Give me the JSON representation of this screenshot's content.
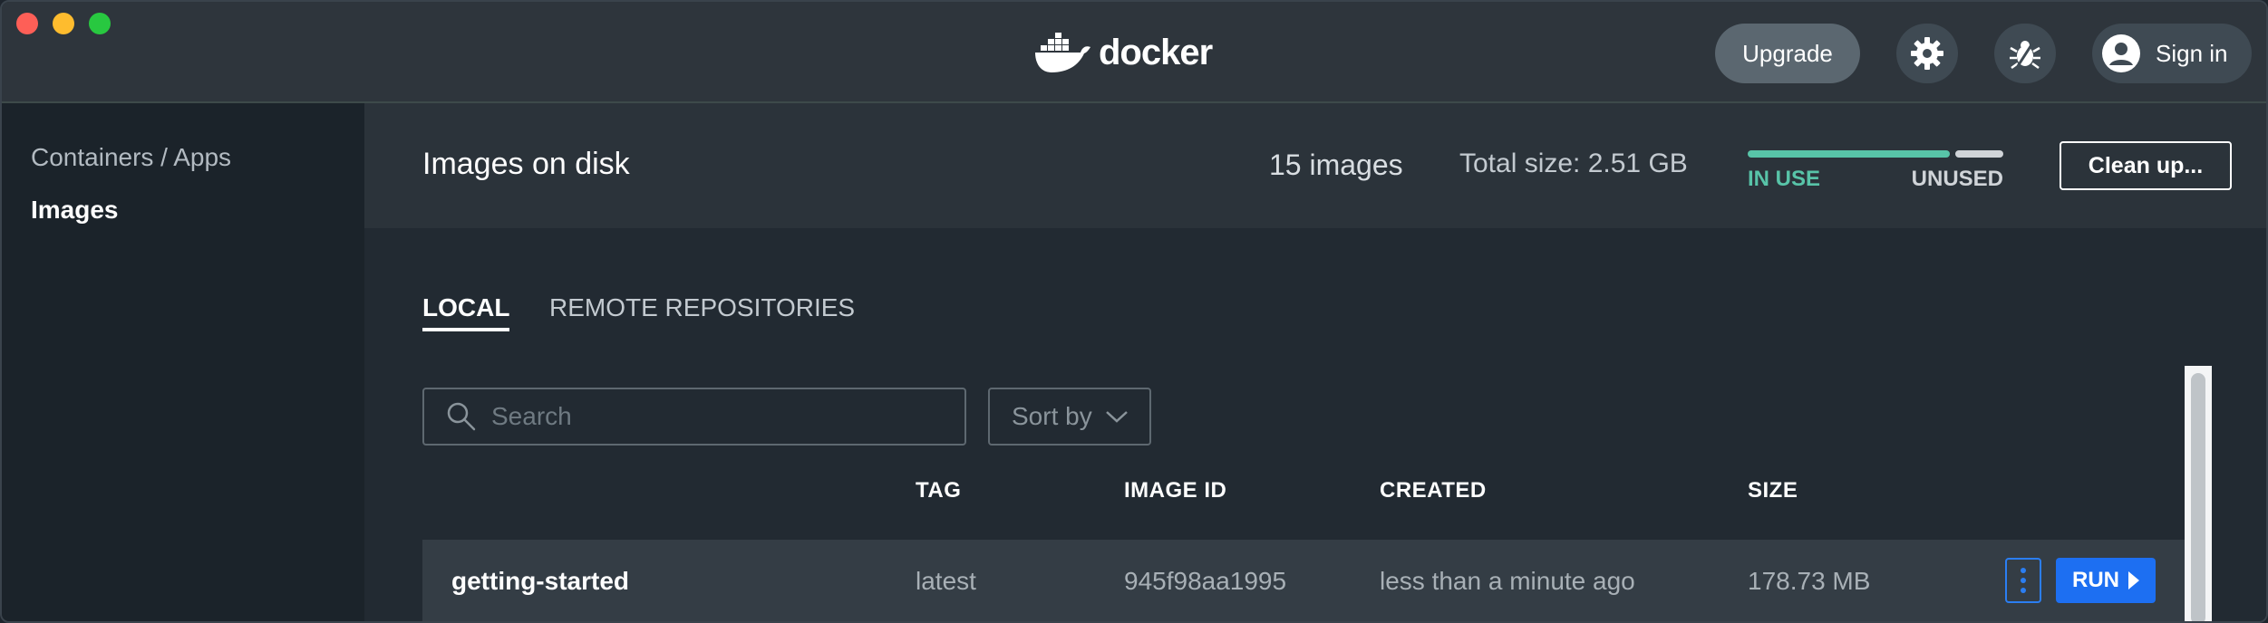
{
  "titlebar": {
    "logo_text": "docker",
    "upgrade_label": "Upgrade",
    "signin_label": "Sign in",
    "icons": [
      "whale-icon",
      "gear-icon",
      "bug-icon",
      "user-icon"
    ]
  },
  "sidebar": {
    "items": [
      {
        "label": "Containers / Apps",
        "selected": false
      },
      {
        "label": "Images",
        "selected": true
      }
    ]
  },
  "header": {
    "title": "Images on disk",
    "image_count": "15 images",
    "total_size": "Total size: 2.51 GB",
    "usage": {
      "in_use_label": "IN USE",
      "unused_label": "UNUSED",
      "in_use_fraction": 0.79
    },
    "cleanup_label": "Clean up..."
  },
  "tabs": [
    {
      "label": "LOCAL",
      "active": true
    },
    {
      "label": "REMOTE REPOSITORIES",
      "active": false
    }
  ],
  "search": {
    "placeholder": "Search",
    "value": ""
  },
  "sort": {
    "label": "Sort by"
  },
  "table": {
    "columns": [
      "TAG",
      "IMAGE ID",
      "CREATED",
      "SIZE"
    ],
    "rows": [
      {
        "name": "getting-started",
        "tag": "latest",
        "image_id": "945f98aa1995",
        "created": "less than a minute ago",
        "size": "178.73 MB",
        "run_label": "RUN"
      }
    ]
  },
  "colors": {
    "accent_green": "#58c4a8",
    "run_blue": "#1d6ff2",
    "background": "#222a32"
  }
}
